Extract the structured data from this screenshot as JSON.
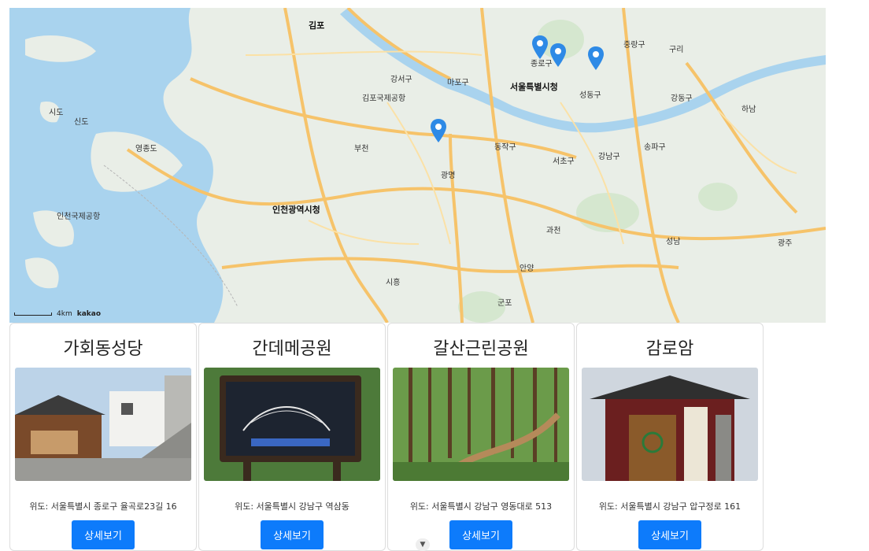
{
  "map": {
    "labels": [
      {
        "text": "김포",
        "cls": "big"
      },
      {
        "text": "서울특별시청",
        "cls": "big"
      },
      {
        "text": "인천광역시청",
        "cls": "big"
      },
      {
        "text": "구리",
        "cls": ""
      },
      {
        "text": "하남",
        "cls": ""
      },
      {
        "text": "광명",
        "cls": ""
      },
      {
        "text": "부천",
        "cls": ""
      },
      {
        "text": "시흥",
        "cls": ""
      },
      {
        "text": "안양",
        "cls": ""
      },
      {
        "text": "과천",
        "cls": ""
      },
      {
        "text": "성남",
        "cls": ""
      },
      {
        "text": "군포",
        "cls": ""
      },
      {
        "text": "광주",
        "cls": ""
      },
      {
        "text": "강남구",
        "cls": ""
      },
      {
        "text": "서초구",
        "cls": ""
      },
      {
        "text": "송파구",
        "cls": ""
      },
      {
        "text": "강서구",
        "cls": ""
      },
      {
        "text": "마포구",
        "cls": ""
      },
      {
        "text": "성동구",
        "cls": ""
      },
      {
        "text": "동작구",
        "cls": ""
      },
      {
        "text": "종로구",
        "cls": ""
      },
      {
        "text": "중랑구",
        "cls": ""
      },
      {
        "text": "영종도",
        "cls": ""
      },
      {
        "text": "신도",
        "cls": ""
      },
      {
        "text": "시도",
        "cls": ""
      },
      {
        "text": "강동구",
        "cls": ""
      },
      {
        "text": "인천국제공항",
        "cls": ""
      },
      {
        "text": "김포국제공항",
        "cls": ""
      }
    ],
    "scale_label": "4km",
    "brand": "kakao"
  },
  "cards": [
    {
      "title": "가회동성당",
      "address": "위도: 서울특별시 종로구 율곡로23길 16",
      "button": "상세보기"
    },
    {
      "title": "간데메공원",
      "address": "위도: 서울특별시 강남구 역삼동",
      "button": "상세보기"
    },
    {
      "title": "갈산근린공원",
      "address": "위도: 서울특별시 강남구 영동대로 513",
      "button": "상세보기"
    },
    {
      "title": "감로암",
      "address": "위도: 서울특별시 강남구 압구정로 161",
      "button": "상세보기"
    }
  ],
  "colors": {
    "accent": "#0d7bfb",
    "water": "#a9d3ee",
    "land": "#e9eee7",
    "road": "#f6c36a"
  }
}
